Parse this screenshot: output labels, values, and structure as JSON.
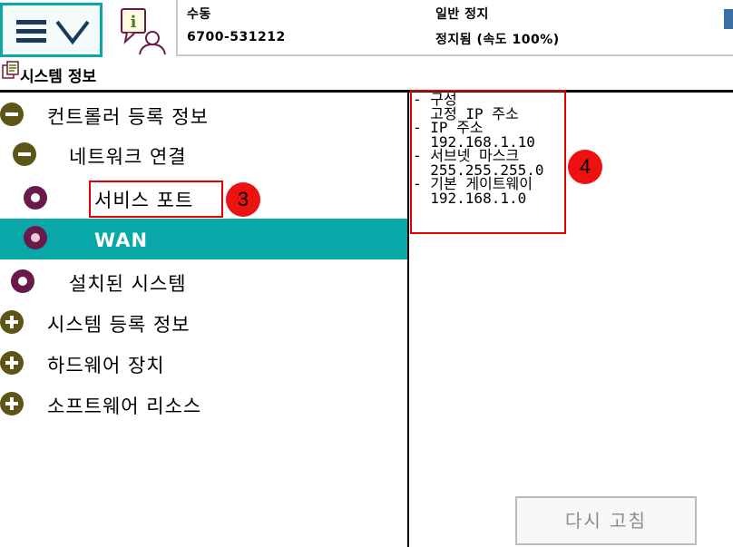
{
  "topbar": {
    "menu_button": {
      "icon": "hamburger-icon",
      "chevron_icon": "chevron-down-icon"
    },
    "quickset_icon": "quickset-info-icon",
    "status": {
      "mode": "수동",
      "robot_id": "6700-531212",
      "state": "일반 정지",
      "speed": "정지됨 (속도 100%)"
    }
  },
  "page": {
    "title_icon": "system-info-icon",
    "title": "시스템 정보"
  },
  "tree": [
    {
      "label": "컨트롤러 등록 정보",
      "icon": "collapse-icon",
      "level": 0,
      "selected": false
    },
    {
      "label": "네트워크 연결",
      "icon": "collapse-icon",
      "level": 1,
      "selected": false
    },
    {
      "label": "서비스 포트",
      "icon": "node-icon",
      "level": 2,
      "selected": false
    },
    {
      "label": "WAN",
      "icon": "node-icon",
      "level": 2,
      "selected": true
    },
    {
      "label": "설치된 시스템",
      "icon": "node-icon",
      "level": 1,
      "selected": false
    },
    {
      "label": "시스템 등록 정보",
      "icon": "expand-icon",
      "level": 0,
      "selected": false
    },
    {
      "label": "하드웨어 장치",
      "icon": "expand-icon",
      "level": 0,
      "selected": false
    },
    {
      "label": "소프트웨어 리소스",
      "icon": "expand-icon",
      "level": 0,
      "selected": false
    }
  ],
  "detail": {
    "lines": [
      "- 구성",
      "  고정 IP 주소",
      "- IP 주소",
      "  192.168.1.10",
      "- 서브넷 마스크",
      "  255.255.255.0",
      "- 기본 게이트웨이",
      "  192.168.1.0"
    ]
  },
  "annotations": {
    "marker_3": "3",
    "marker_4": "4",
    "color": "#e00000"
  },
  "refresh_button": {
    "label": "다시 고침"
  },
  "colors": {
    "accent": "#0aa7a9",
    "expand_icon": "#5d5418",
    "node_icon": "#6a1a4a"
  }
}
